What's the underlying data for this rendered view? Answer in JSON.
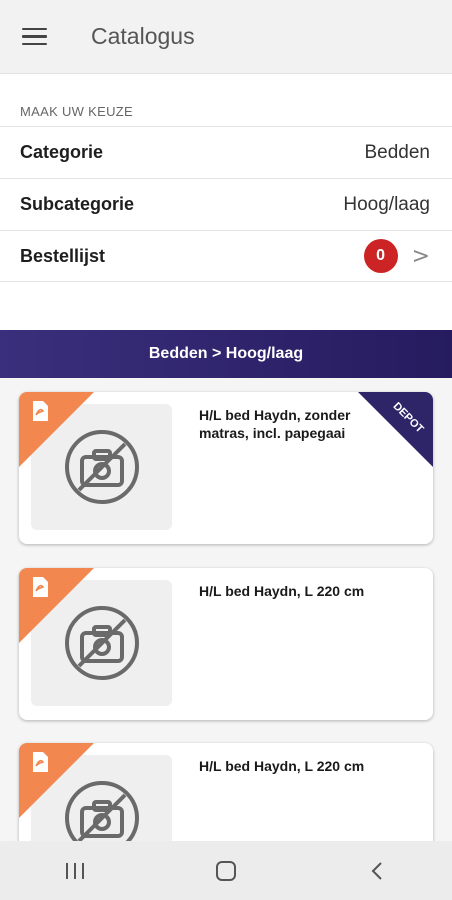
{
  "appbar": {
    "title": "Catalogus",
    "menu_icon": "menu-icon"
  },
  "selection": {
    "section_label": "MAAK UW KEUZE",
    "category": {
      "label": "Categorie",
      "value": "Bedden"
    },
    "subcategory": {
      "label": "Subcategorie",
      "value": "Hoog/laag"
    },
    "orderlist": {
      "label": "Bestellijst",
      "count": "0",
      "chevron": ">"
    }
  },
  "breadcrumb": "Bedden > Hoog/laag",
  "products": [
    {
      "title": "H/L bed Haydn, zonder matras, incl. papegaai",
      "ribbon": "DEPOT",
      "thumb_icon": "no-photo-icon"
    },
    {
      "title": "H/L bed Haydn, L 220 cm",
      "thumb_icon": "no-photo-icon"
    },
    {
      "title": "H/L bed Haydn, L 220 cm",
      "thumb_icon": "no-photo-icon"
    }
  ],
  "colors": {
    "accent_orange": "#f2874f",
    "banner_purple": "#2e2468",
    "badge_red": "#cc2424"
  }
}
